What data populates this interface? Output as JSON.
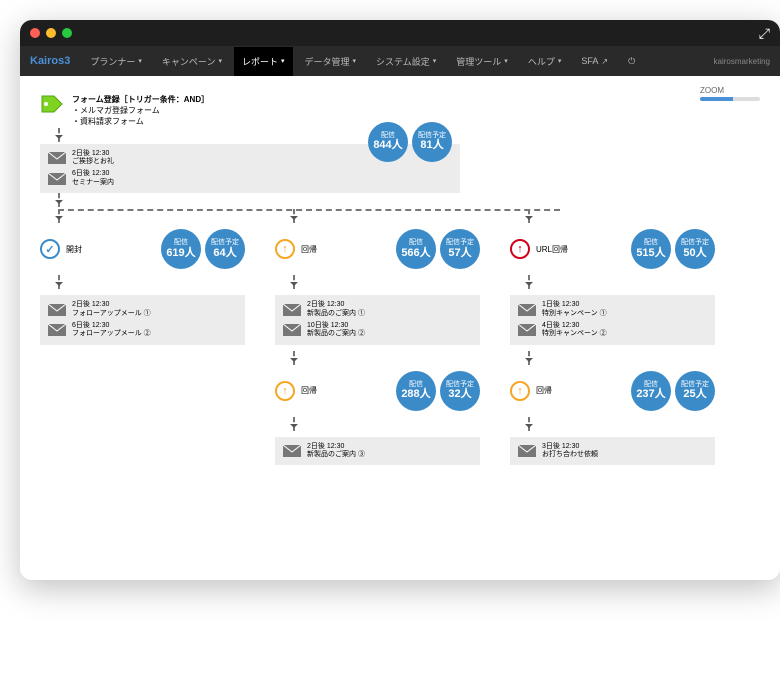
{
  "window": {
    "brand": "Kairos3",
    "user": "kairosmarketing"
  },
  "nav": {
    "items": [
      "プランナー",
      "キャンペーン",
      "レポート",
      "データ管理",
      "システム設定",
      "管理ツール",
      "ヘルプ",
      "SFA"
    ],
    "active": 2,
    "power": "⏻"
  },
  "zoom_label": "ZOOM",
  "suffix": "人",
  "labels": {
    "sent": "配信",
    "sched": "配信予定"
  },
  "trigger": {
    "title": "フォーム登録［トリガー条件：AND］",
    "lines": [
      "・メルマガ登録フォーム",
      "・資料請求フォーム"
    ]
  },
  "root": {
    "sent": 844,
    "sched": 81,
    "mails": [
      {
        "time": "2日後 12:30",
        "subj": "ご挨拶とお礼"
      },
      {
        "time": "6日後 12:30",
        "subj": "セミナー案内"
      }
    ]
  },
  "branches": [
    {
      "icon": "check",
      "color": "blue",
      "label": "開封",
      "sent": 619,
      "sched": 64,
      "mails": [
        {
          "time": "2日後 12:30",
          "subj": "フォローアップメール ①"
        },
        {
          "time": "6日後 12:30",
          "subj": "フォローアップメール ②"
        }
      ]
    },
    {
      "icon": "up",
      "color": "orange",
      "label": "回帰",
      "sent": 566,
      "sched": 57,
      "mails": [
        {
          "time": "2日後 12:30",
          "subj": "新製品のご案内 ①"
        },
        {
          "time": "10日後 12:30",
          "subj": "新製品のご案内 ②"
        }
      ],
      "child": {
        "icon": "up",
        "color": "orange",
        "label": "回帰",
        "sent": 288,
        "sched": 32,
        "mails": [
          {
            "time": "2日後 12:30",
            "subj": "新製品のご案内 ③"
          }
        ]
      }
    },
    {
      "icon": "up",
      "color": "red",
      "label": "URL回帰",
      "sent": 515,
      "sched": 50,
      "mails": [
        {
          "time": "1日後 12:30",
          "subj": "特別キャンペーン ①"
        },
        {
          "time": "4日後 12:30",
          "subj": "特別キャンペーン ②"
        }
      ],
      "child": {
        "icon": "up",
        "color": "orange",
        "label": "回帰",
        "sent": 237,
        "sched": 25,
        "mails": [
          {
            "time": "3日後 12:30",
            "subj": "お打ち合わせ依頼"
          }
        ]
      }
    }
  ]
}
